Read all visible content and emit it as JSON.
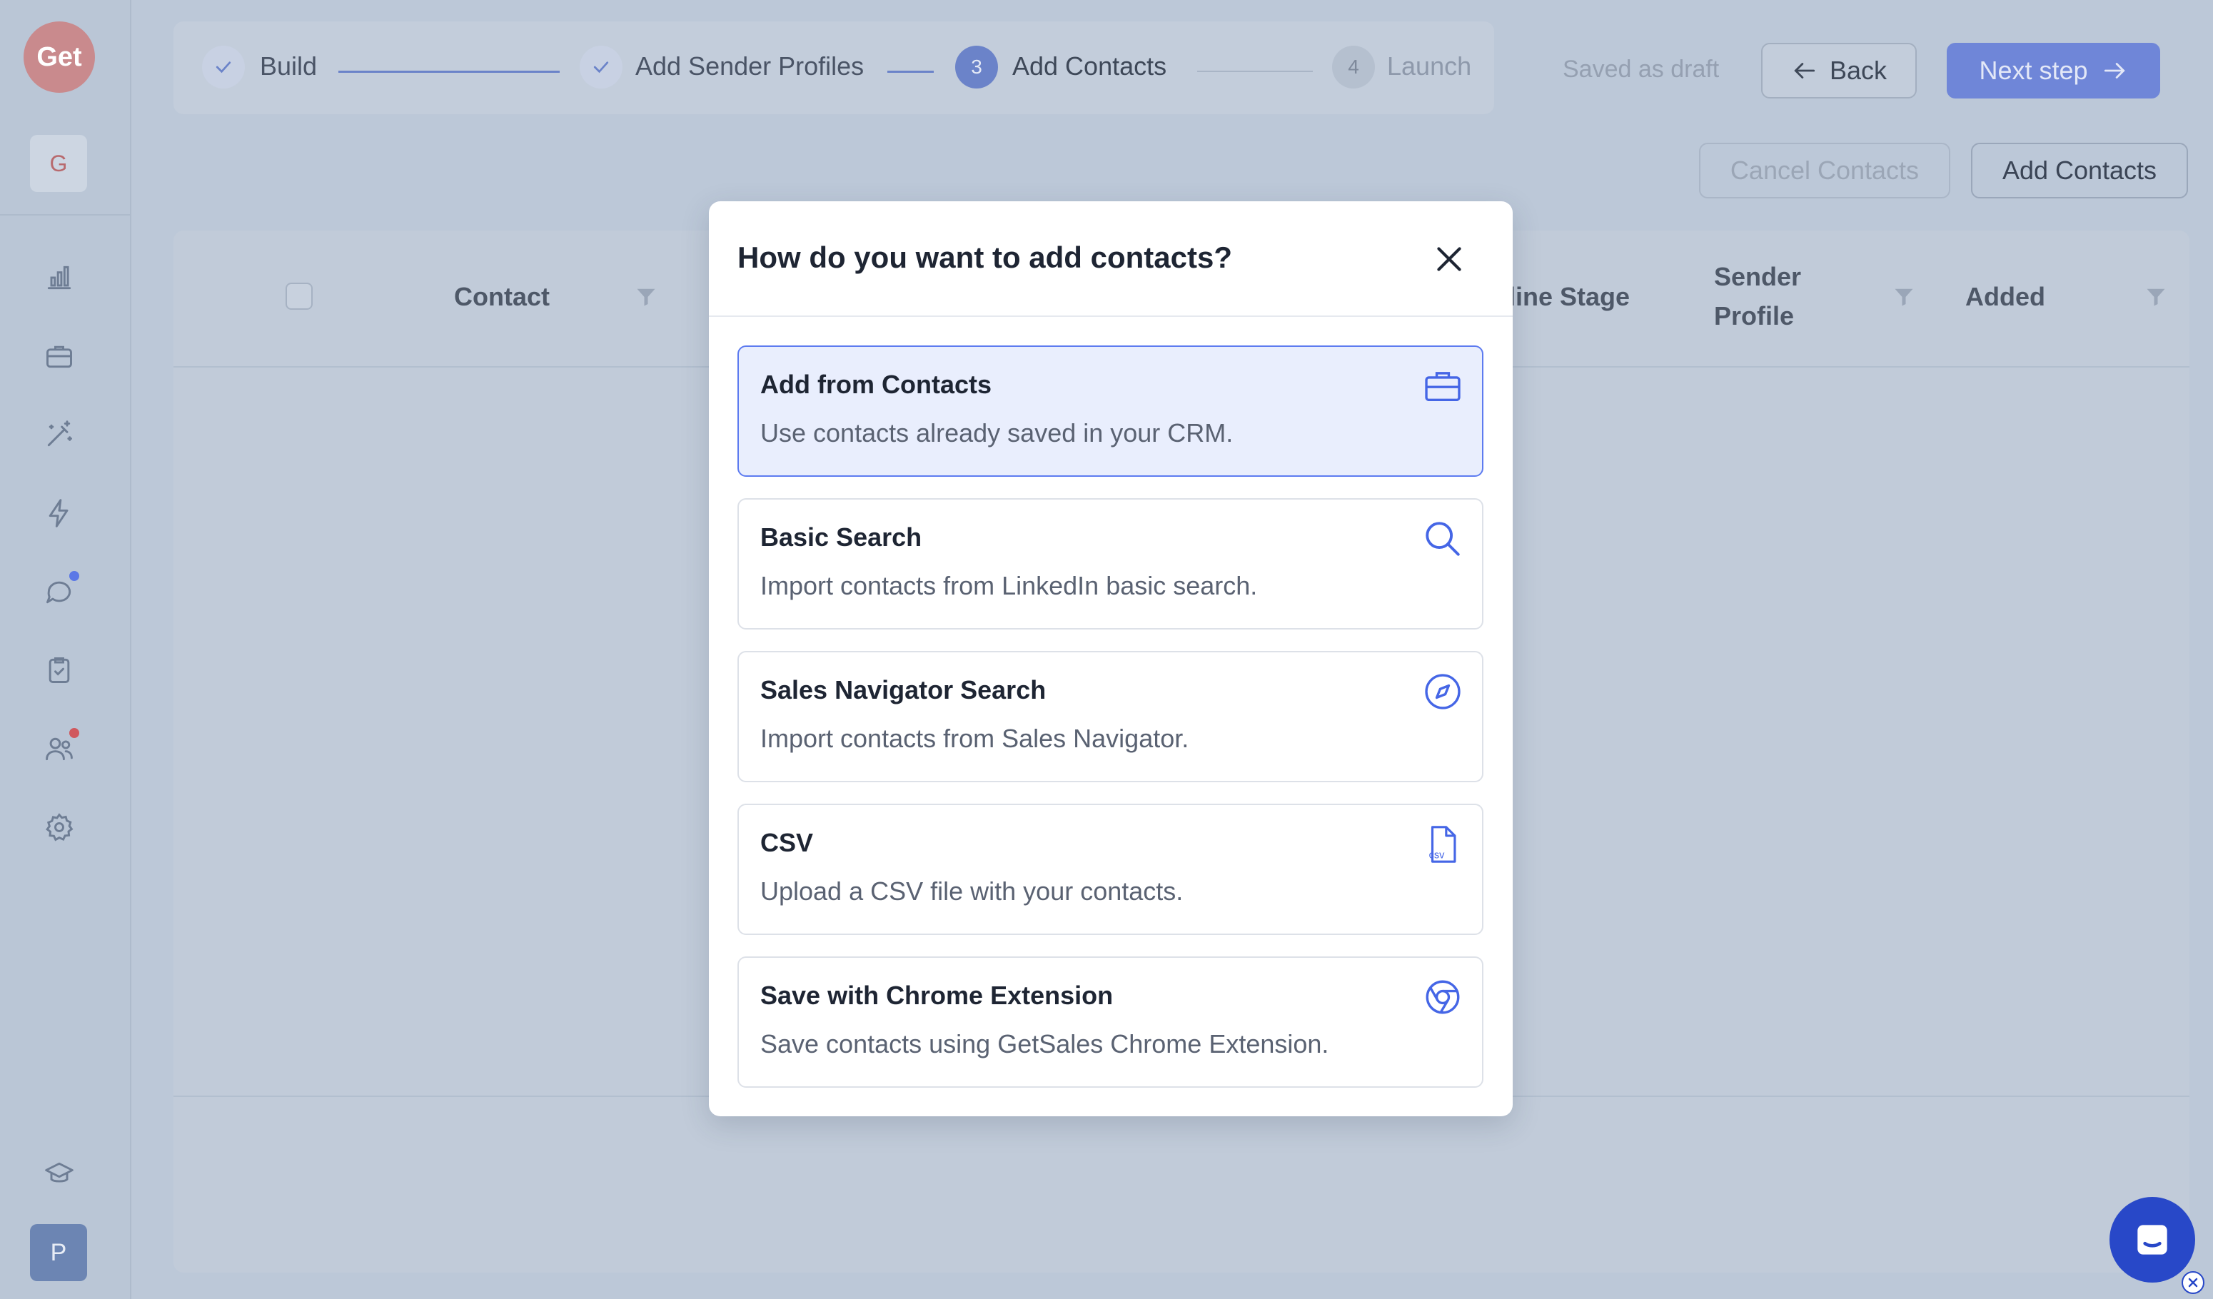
{
  "sidebar": {
    "logo_text": "Get",
    "workspace_initial": "G",
    "user_initial": "P",
    "nav_icons": [
      "chart-icon",
      "briefcase-icon",
      "magic-wand-icon",
      "lightning-icon",
      "chat-icon",
      "clipboard-check-icon",
      "team-icon",
      "gear-icon",
      "graduation-cap-icon"
    ]
  },
  "stepper": {
    "steps": [
      {
        "number": "",
        "label": "Build",
        "state": "done"
      },
      {
        "number": "",
        "label": "Add Sender Profiles",
        "state": "done"
      },
      {
        "number": "3",
        "label": "Add Contacts",
        "state": "active"
      },
      {
        "number": "4",
        "label": "Launch",
        "state": "pending"
      }
    ],
    "draft_status": "Saved as draft",
    "back_label": "Back",
    "next_label": "Next step"
  },
  "actions": {
    "cancel_label": "Cancel Contacts",
    "add_label": "Add Contacts"
  },
  "table": {
    "columns": [
      "Contact",
      "line Stage",
      "Sender Profile",
      "Added"
    ]
  },
  "modal": {
    "title": "How do you want to add contacts?",
    "options": [
      {
        "title": "Add from Contacts",
        "description": "Use contacts already saved in your CRM.",
        "icon": "briefcase-icon",
        "selected": true
      },
      {
        "title": "Basic Search",
        "description": "Import contacts from LinkedIn basic search.",
        "icon": "search-icon",
        "selected": false
      },
      {
        "title": "Sales Navigator Search",
        "description": "Import contacts from Sales Navigator.",
        "icon": "compass-icon",
        "selected": false
      },
      {
        "title": "CSV",
        "description": "Upload a CSV file with your contacts.",
        "icon": "csv-file-icon",
        "csv_glyph": "csv",
        "selected": false
      },
      {
        "title": "Save with Chrome Extension",
        "description": "Save contacts using GetSales Chrome Extension.",
        "icon": "chrome-icon",
        "selected": false
      }
    ]
  },
  "colors": {
    "accent": "#5d7bf0",
    "overlay_bg": "#bcc8d8",
    "chat_bubble": "#2848c8",
    "notification_blue": "#5b78e6",
    "notification_red": "#d0585e"
  }
}
